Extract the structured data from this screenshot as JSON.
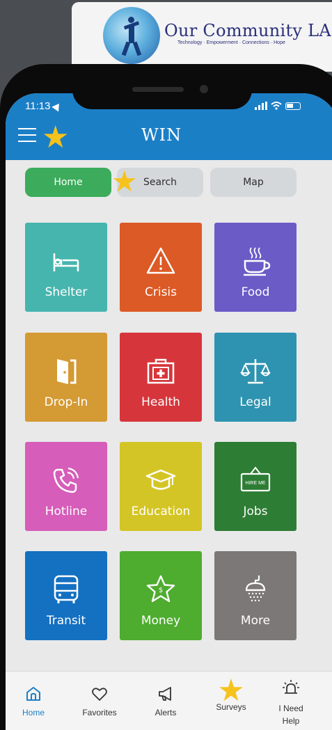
{
  "banner": {
    "title": "Our Community LA",
    "subtitle": "Technology · Empowerment · Connections · Hope"
  },
  "status_bar": {
    "time": "11:13"
  },
  "app": {
    "brand": "WIN"
  },
  "tabs": [
    {
      "label": "Home",
      "active": true
    },
    {
      "label": "Search",
      "active": false
    },
    {
      "label": "Map",
      "active": false
    }
  ],
  "categories": [
    {
      "label": "Shelter",
      "icon": "bed-icon",
      "color": "#46b5ae"
    },
    {
      "label": "Crisis",
      "icon": "warning-icon",
      "color": "#dc5a25"
    },
    {
      "label": "Food",
      "icon": "coffee-cup-icon",
      "color": "#6a5bc7"
    },
    {
      "label": "Drop-In",
      "icon": "door-icon",
      "color": "#d49a33"
    },
    {
      "label": "Health",
      "icon": "medical-kit-icon",
      "color": "#d6363b"
    },
    {
      "label": "Legal",
      "icon": "scales-icon",
      "color": "#2e93b0"
    },
    {
      "label": "Hotline",
      "icon": "phone-ringing-icon",
      "color": "#d65db9"
    },
    {
      "label": "Education",
      "icon": "graduation-cap-icon",
      "color": "#d4c526"
    },
    {
      "label": "Jobs",
      "icon": "hire-me-sign-icon",
      "color": "#2e7d35"
    },
    {
      "label": "Transit",
      "icon": "bus-icon",
      "color": "#1470c1"
    },
    {
      "label": "Money",
      "icon": "money-star-icon",
      "color": "#4eac2f"
    },
    {
      "label": "More",
      "icon": "shower-icon",
      "color": "#7c7878"
    }
  ],
  "jobs_sign_text": "HIRE ME",
  "money_sign_text": "$",
  "bottom_nav": [
    {
      "label": "Home",
      "icon": "home-icon",
      "active": true
    },
    {
      "label": "Favorites",
      "icon": "heart-icon",
      "active": false
    },
    {
      "label": "Alerts",
      "icon": "megaphone-icon",
      "active": false
    },
    {
      "label": "Surveys",
      "icon": "star-icon",
      "active": false
    },
    {
      "label": "I Need Help",
      "icon": "alarm-icon",
      "active": false
    }
  ],
  "colors": {
    "header_blue": "#1b7fc6",
    "home_tab_green": "#3cac5c",
    "star_yellow": "#f6c21c",
    "screen_bg": "#e9e9e9"
  }
}
